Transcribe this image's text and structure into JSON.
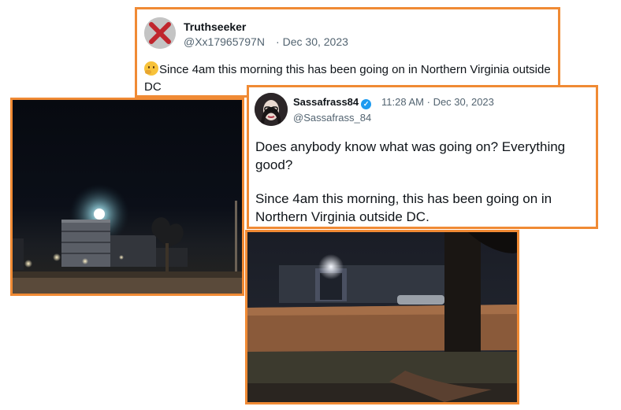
{
  "tweets": [
    {
      "display_name": "Truthseeker",
      "handle": "@Xx17965797N",
      "separator": "·",
      "date": "Dec 30, 2023",
      "text": "Since 4am this morning this has been going on in Northern Virginia outside DC",
      "emoji": "thinking-face-icon",
      "avatar": "red-x-icon"
    },
    {
      "display_name": "Sassafrass84",
      "verified": true,
      "handle": "@Sassafrass_84",
      "time": "11:28 AM",
      "separator": "·",
      "date": "Dec 30, 2023",
      "text_paragraph_1": "Does anybody know what was going on? Everything good?",
      "text_paragraph_2": "Since 4am this morning, this has been going on in Northern Virginia outside DC."
    }
  ],
  "colors": {
    "frame_border": "#f08a34",
    "verified_badge": "#1d9bf0",
    "handle_gray": "#536471",
    "text_dark": "#0f1419"
  },
  "photos": [
    {
      "subject": "night sky with bright light over buildings and street lamps"
    },
    {
      "subject": "night street scene with lit building, hedge and tree trunk"
    }
  ]
}
